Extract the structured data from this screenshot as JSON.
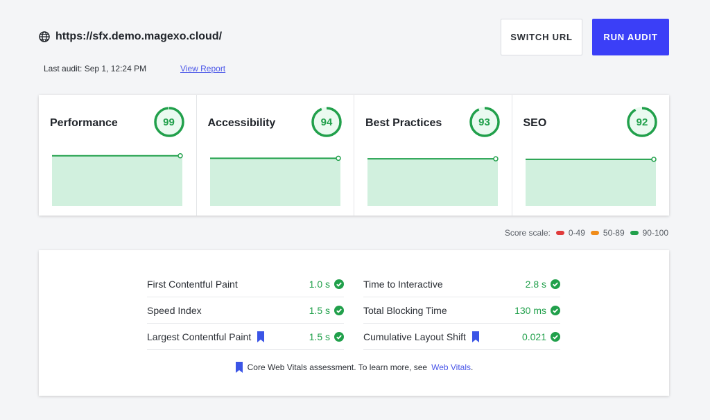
{
  "header": {
    "url": "https://sfx.demo.magexo.cloud/",
    "last_audit": "Last audit: Sep 1, 12:24 PM",
    "view_report": "View Report",
    "switch_url": "SWITCH URL",
    "run_audit": "RUN AUDIT"
  },
  "scores": [
    {
      "title": "Performance",
      "score": 99
    },
    {
      "title": "Accessibility",
      "score": 94
    },
    {
      "title": "Best Practices",
      "score": 93
    },
    {
      "title": "SEO",
      "score": 92
    }
  ],
  "legend": {
    "label": "Score scale:",
    "items": [
      {
        "label": "0-49",
        "color": "#e03b3b"
      },
      {
        "label": "50-89",
        "color": "#f08c1a"
      },
      {
        "label": "90-100",
        "color": "#21a04b"
      }
    ]
  },
  "metrics": {
    "left": [
      {
        "name": "First Contentful Paint",
        "value": "1.0 s",
        "bookmark": false
      },
      {
        "name": "Speed Index",
        "value": "1.5 s",
        "bookmark": false
      },
      {
        "name": "Largest Contentful Paint",
        "value": "1.5 s",
        "bookmark": true
      }
    ],
    "right": [
      {
        "name": "Time to Interactive",
        "value": "2.8 s",
        "bookmark": false
      },
      {
        "name": "Total Blocking Time",
        "value": "130 ms",
        "bookmark": false
      },
      {
        "name": "Cumulative Layout Shift",
        "value": "0.021",
        "bookmark": true
      }
    ],
    "footnote_text": "Core Web Vitals assessment. To learn more, see",
    "footnote_link": "Web Vitals",
    "footnote_end": "."
  },
  "colors": {
    "accent": "#3b3ff7",
    "good": "#21a04b",
    "good_fill": "#d1f0de",
    "link": "#4b57e8"
  }
}
